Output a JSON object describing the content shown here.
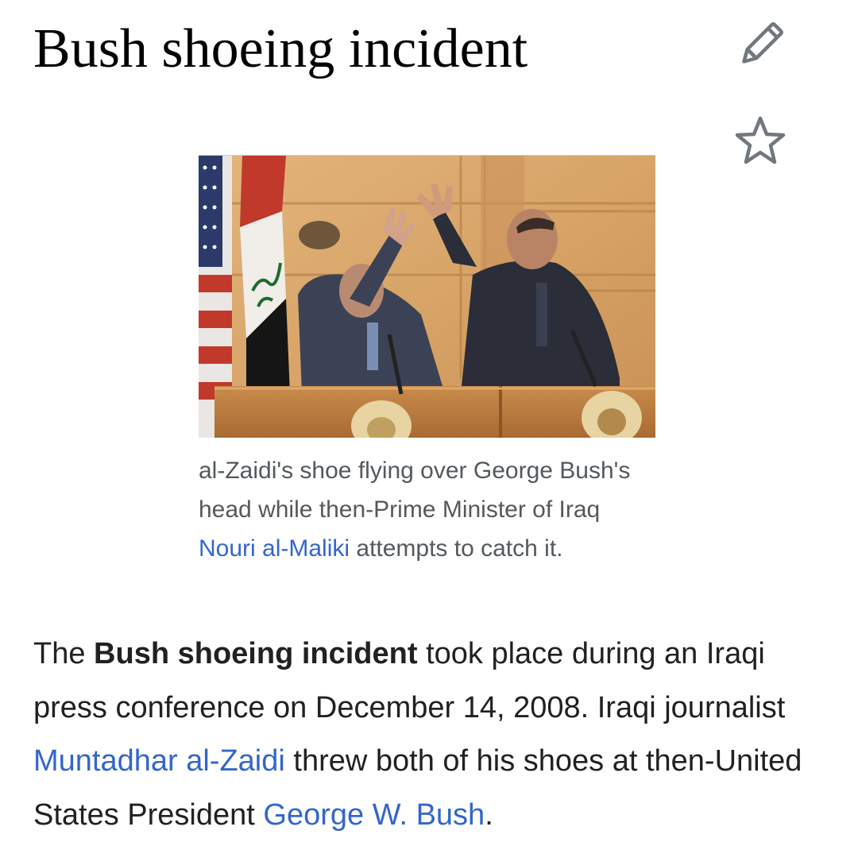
{
  "article": {
    "title": "Bush shoeing incident"
  },
  "actions": {
    "edit_icon": "pencil-icon",
    "watch_icon": "star-icon"
  },
  "figure": {
    "image_description": "photo",
    "caption_part1": "al-Zaidi's shoe flying over George Bush's head while then-Prime Minister of Iraq ",
    "caption_link": "Nouri al-Maliki",
    "caption_part2": " attempts to catch it."
  },
  "lead": {
    "text1": "The ",
    "bold": "Bush shoeing incident",
    "text2": " took place during an Iraqi press conference on December 14, 2008. Iraqi journalist ",
    "link1": "Muntadhar al-Zaidi",
    "text3": " threw both of his shoes at then-United States President ",
    "link2": "George W. Bush",
    "text4": "."
  },
  "colors": {
    "link": "#3366cc",
    "caption": "#54595d",
    "text": "#202122",
    "icon": "#72777d"
  }
}
